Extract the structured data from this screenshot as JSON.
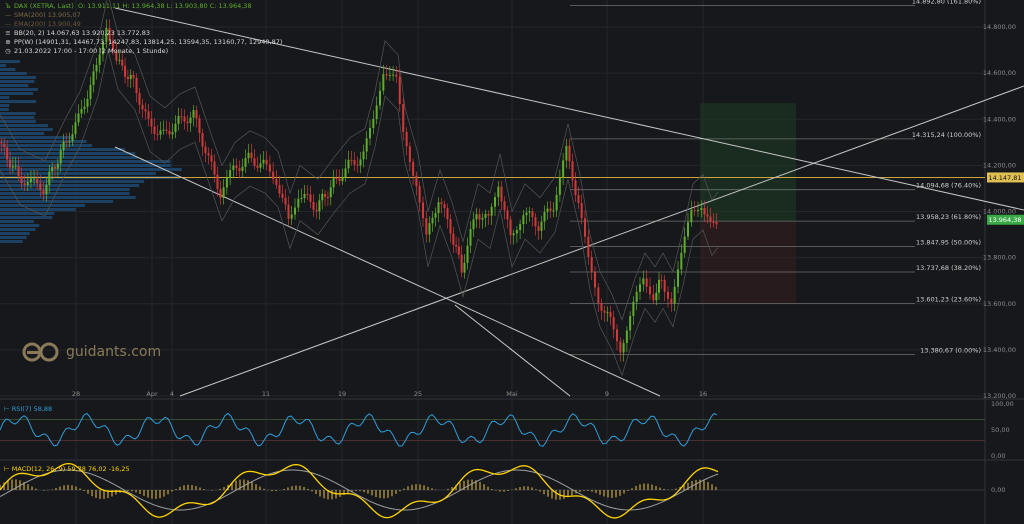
{
  "legend": {
    "symbol": {
      "text": "DAX (XETRA, Last)",
      "ohlc": "O: 13.911,11  H: 13.964,38  L: 13.903,80  C: 13.964,38"
    },
    "sma200": "SMA(200)  13.905,07",
    "ema200": "EMA(200)  13.900,49",
    "bb": "BB(20, 2)  14.067,63  13.920,23  13.772,83",
    "pp": "PP(W)  (14901,31, 14467,73, 14247,83, 13814,25, 13594,35, 13160,77, 12940,87)",
    "period": "21.03.2022 17:00 - 17:00  (2 Monate, 1 Stunde)"
  },
  "brand": {
    "name": "guidants.com"
  },
  "colors": {
    "background": "#16181c",
    "grid": "#23262c",
    "up": "#5fae2b",
    "down": "#d23a3a",
    "price_label": "#39a845",
    "fib_label": "#e0c050",
    "rsi": "#2f9ed8",
    "macd": "#ffd400",
    "signal": "#a0a0a0",
    "hist": "#c9a640"
  },
  "chart_data": {
    "type": "line",
    "title": "DAX (XETRA, Last)",
    "xlabel": "",
    "ylabel": "",
    "x_ticks": [
      "28",
      "Apr",
      "4",
      "11",
      "19",
      "25",
      "Mai",
      "9",
      "16"
    ],
    "ylim": [
      13200,
      14900
    ],
    "y_ticks": [
      14800,
      14600,
      14400,
      14200,
      14000,
      13800,
      13600,
      13400,
      13200
    ],
    "y_tick_labels": [
      "14.800,00",
      "14.600,00",
      "14.400,00",
      "14.200,00",
      "14.000,00",
      "13.800,00",
      "13.600,00",
      "13.400,00",
      "13.200,00"
    ],
    "current_price": 13964.38,
    "current_price_label": "13.964,38",
    "pivot_label_price": 14147.81,
    "pivot_label": "14.147,81",
    "fib_levels": [
      {
        "value": 14892.8,
        "label": "14.892,80 (161.80%)"
      },
      {
        "value": 14315.24,
        "label": "14.315,24 (100.00%)"
      },
      {
        "value": 14094.68,
        "label": "14.094,68 (76.40%)"
      },
      {
        "value": 13958.23,
        "label": "13.958,23 (61.80%)"
      },
      {
        "value": 13847.95,
        "label": "13.847,95 (50.00%)"
      },
      {
        "value": 13737.68,
        "label": "13.737,68 (38.20%)"
      },
      {
        "value": 13601.23,
        "label": "13.601,23 (23.60%)"
      },
      {
        "value": 13380.67,
        "label": "13.380,67 (0.00%)"
      }
    ],
    "price_path": [
      {
        "x": 0,
        "y": 14300
      },
      {
        "x": 20,
        "y": 14150
      },
      {
        "x": 45,
        "y": 14100
      },
      {
        "x": 65,
        "y": 14280
      },
      {
        "x": 80,
        "y": 14400
      },
      {
        "x": 98,
        "y": 14620
      },
      {
        "x": 108,
        "y": 14820
      },
      {
        "x": 118,
        "y": 14650
      },
      {
        "x": 135,
        "y": 14560
      },
      {
        "x": 150,
        "y": 14380
      },
      {
        "x": 165,
        "y": 14330
      },
      {
        "x": 180,
        "y": 14390
      },
      {
        "x": 195,
        "y": 14420
      },
      {
        "x": 210,
        "y": 14230
      },
      {
        "x": 222,
        "y": 14080
      },
      {
        "x": 235,
        "y": 14180
      },
      {
        "x": 250,
        "y": 14230
      },
      {
        "x": 265,
        "y": 14200
      },
      {
        "x": 278,
        "y": 14140
      },
      {
        "x": 290,
        "y": 13960
      },
      {
        "x": 300,
        "y": 14080
      },
      {
        "x": 318,
        "y": 14020
      },
      {
        "x": 335,
        "y": 14120
      },
      {
        "x": 350,
        "y": 14200
      },
      {
        "x": 365,
        "y": 14240
      },
      {
        "x": 375,
        "y": 14400
      },
      {
        "x": 385,
        "y": 14620
      },
      {
        "x": 398,
        "y": 14560
      },
      {
        "x": 405,
        "y": 14330
      },
      {
        "x": 418,
        "y": 14130
      },
      {
        "x": 428,
        "y": 13880
      },
      {
        "x": 440,
        "y": 14060
      },
      {
        "x": 452,
        "y": 13920
      },
      {
        "x": 463,
        "y": 13750
      },
      {
        "x": 478,
        "y": 14000
      },
      {
        "x": 490,
        "y": 13960
      },
      {
        "x": 500,
        "y": 14130
      },
      {
        "x": 512,
        "y": 13880
      },
      {
        "x": 525,
        "y": 14000
      },
      {
        "x": 540,
        "y": 13940
      },
      {
        "x": 555,
        "y": 14030
      },
      {
        "x": 568,
        "y": 14260
      },
      {
        "x": 580,
        "y": 14040
      },
      {
        "x": 590,
        "y": 13780
      },
      {
        "x": 600,
        "y": 13620
      },
      {
        "x": 612,
        "y": 13520
      },
      {
        "x": 622,
        "y": 13410
      },
      {
        "x": 635,
        "y": 13590
      },
      {
        "x": 645,
        "y": 13700
      },
      {
        "x": 655,
        "y": 13640
      },
      {
        "x": 663,
        "y": 13700
      },
      {
        "x": 673,
        "y": 13620
      },
      {
        "x": 683,
        "y": 13800
      },
      {
        "x": 693,
        "y": 14000
      },
      {
        "x": 703,
        "y": 14040
      },
      {
        "x": 712,
        "y": 13930
      },
      {
        "x": 718,
        "y": 13964
      }
    ],
    "rsi": {
      "label": "RSI(7)  58,88",
      "value": 58.88,
      "levels": [
        100,
        50,
        0
      ],
      "level_labels": [
        "100,00",
        "50,00",
        "0,00"
      ]
    },
    "macd": {
      "label": "MACD(12, 26, 9)  59,78  76,02  -16,25",
      "zero_label": "0,00"
    }
  }
}
